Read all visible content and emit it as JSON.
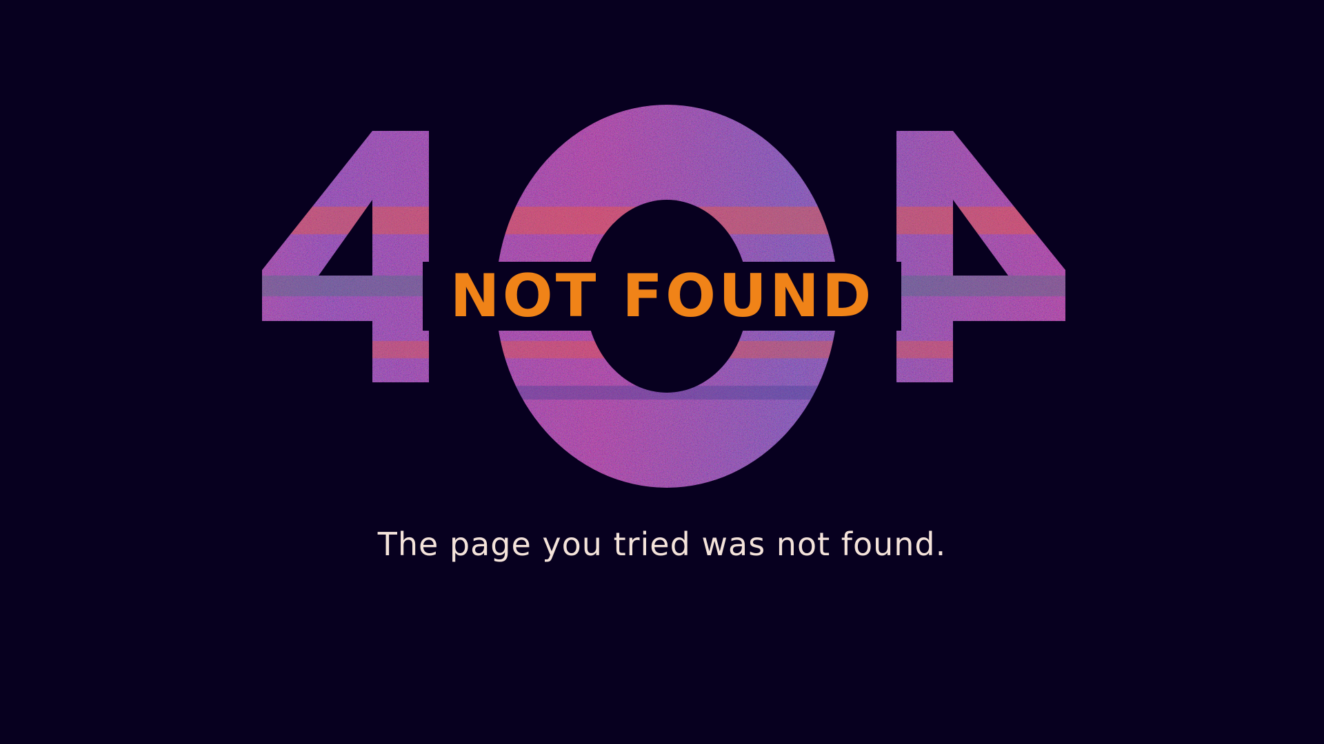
{
  "error": {
    "code_digits": [
      "4",
      "0",
      "4"
    ],
    "label": "NOT FOUND",
    "message": "The page you tried was not found."
  },
  "colors": {
    "background": "#07001f",
    "label": "#f08318",
    "message": "#f4e3da",
    "glitch": [
      "#e0163f",
      "#8a1a6e",
      "#3a3c8e",
      "#ff5a1f",
      "#2f7a6f",
      "#5b2a8a"
    ]
  }
}
